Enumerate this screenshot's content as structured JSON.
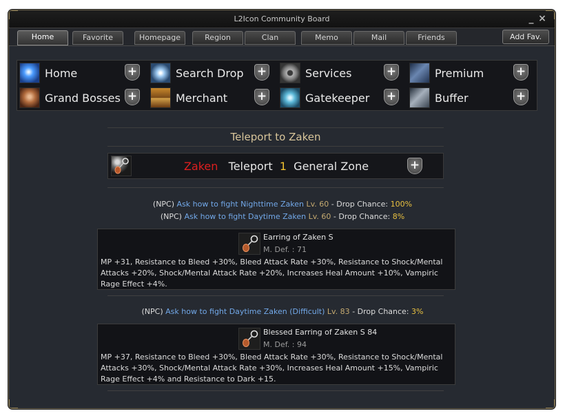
{
  "window": {
    "title": "L2Icon Community Board",
    "minimize_glyph": "_",
    "close_glyph": "×"
  },
  "tabs": [
    {
      "label": "Home",
      "active": true
    },
    {
      "label": "Favorite"
    },
    {
      "label": "Homepage"
    },
    {
      "label": "Region"
    },
    {
      "label": "Clan"
    },
    {
      "label": "Memo"
    },
    {
      "label": "Mail"
    },
    {
      "label": "Friends"
    }
  ],
  "add_fav_label": "Add Fav.",
  "nav": [
    {
      "label": "Home",
      "icon": "blue-burst-icon"
    },
    {
      "label": "Search Drop",
      "icon": "crystal-burst-icon"
    },
    {
      "label": "Services",
      "icon": "gear-icon"
    },
    {
      "label": "Premium",
      "icon": "armored-figure-icon"
    },
    {
      "label": "Grand Bosses",
      "icon": "dragon-icon"
    },
    {
      "label": "Merchant",
      "icon": "treasure-chest-icon"
    },
    {
      "label": "Gatekeeper",
      "icon": "swirl-icon"
    },
    {
      "label": "Buffer",
      "icon": "knight-icon"
    }
  ],
  "plus_glyph": "+",
  "teleport": {
    "title": "Teleport to Zaken",
    "name": "Zaken",
    "action": "Teleport",
    "count": "1",
    "zone": "General Zone",
    "icon": "earring-icon"
  },
  "npc_lines": [
    {
      "prefix": "(NPC)",
      "link": "Ask how to fight Nighttime  Zaken",
      "level": "Lv. 60",
      "sep": "-",
      "drop_label": "Drop Chance:",
      "drop_value": "100%"
    },
    {
      "prefix": "(NPC)",
      "link": "Ask how to fight Daytime  Zaken",
      "level": "Lv. 60",
      "sep": "-",
      "drop_label": "Drop Chance:",
      "drop_value": "8%"
    },
    {
      "prefix": "(NPC)",
      "link": "Ask how to fight Daytime  Zaken (Difficult)",
      "level": "Lv. 83",
      "sep": "-",
      "drop_label": "Drop Chance:",
      "drop_value": "3%"
    }
  ],
  "items": [
    {
      "name": "Earring of Zaken  S",
      "def": "M. Def. : 71",
      "desc": "MP +31, Resistance to Bleed +30%, Bleed Attack Rate +30%, Resistance to Shock/Mental Attacks +20%, Shock/Mental Attack Rate +20%, Increases Heal Amount +10%, Vampiric Rage Effect +4%."
    },
    {
      "name": "Blessed Earring of Zaken  S 84",
      "def": "M. Def. : 94",
      "desc": "MP +37, Resistance to Bleed +30%, Bleed Attack Rate +30%, Resistance to Shock/Mental Attacks +30%, Shock/Mental Attack Rate +30%, Increases Heal Amount +15%, Vampiric Rage Effect +4% and Resistance to Dark +15."
    }
  ],
  "colors": {
    "boss_name": "#dd1f1f",
    "count": "#f0c030",
    "link": "#72a8e8",
    "level": "#c5aa70",
    "drop_value": "#e8c040",
    "teleport_title": "#d8c59a"
  }
}
